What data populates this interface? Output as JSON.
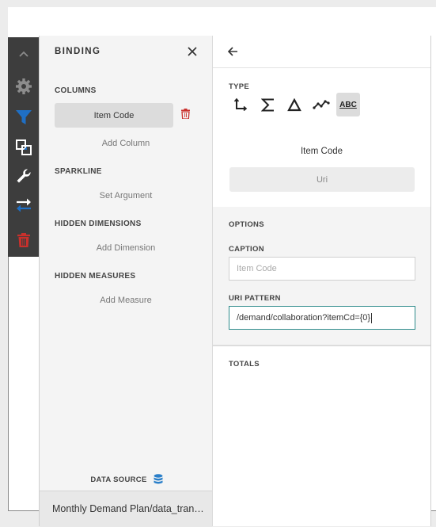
{
  "toolbar": {
    "items": [
      {
        "icon": "chevron-up-icon"
      },
      {
        "icon": "gear-icon"
      },
      {
        "icon": "filter-icon"
      },
      {
        "icon": "interactivity-icon"
      },
      {
        "icon": "wrench-icon"
      },
      {
        "icon": "convert-icon"
      },
      {
        "icon": "trash-icon"
      }
    ]
  },
  "binding": {
    "title": "BINDING",
    "columns_header": "COLUMNS",
    "column_item": "Item Code",
    "add_column": "Add Column",
    "sparkline_header": "SPARKLINE",
    "set_argument": "Set Argument",
    "hidden_dimensions_header": "HIDDEN DIMENSIONS",
    "add_dimension": "Add Dimension",
    "hidden_measures_header": "HIDDEN MEASURES",
    "add_measure": "Add Measure",
    "data_source_label": "DATA SOURCE",
    "data_source_name": "Monthly Demand Plan/data_transfer_demand_plan"
  },
  "options": {
    "type_header": "TYPE",
    "type_icons": [
      "axis-icon",
      "sigma-icon",
      "delta-icon",
      "sparkline-icon",
      "abc-icon"
    ],
    "type_selected": "abc-icon",
    "abc_label": "ABC",
    "field_name": "Item Code",
    "column_type": "Uri",
    "options_header": "OPTIONS",
    "caption_label": "CAPTION",
    "caption_placeholder": "Item Code",
    "uri_pattern_label": "URI PATTERN",
    "uri_pattern_value": "/demand/collaboration?itemCd={0}",
    "totals_header": "TOTALS"
  },
  "colors": {
    "toolbar_bg": "#3d3d3d",
    "filter_blue": "#1f6fc4",
    "delete_red": "#c9302c",
    "focus_teal": "#2e8b8b"
  }
}
